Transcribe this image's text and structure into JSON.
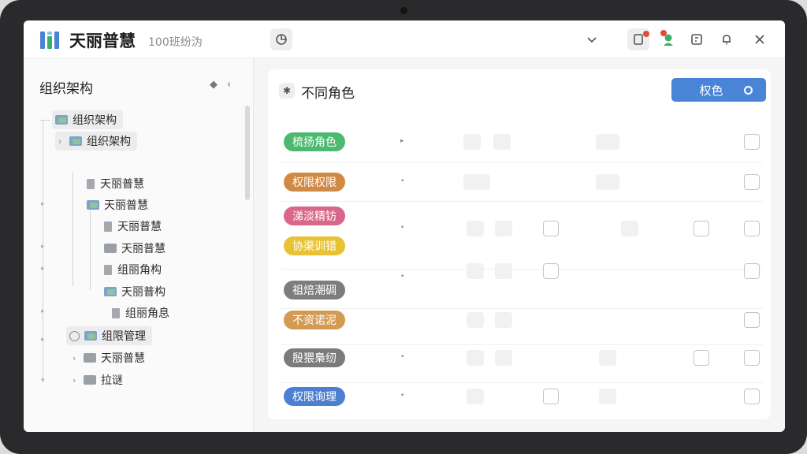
{
  "header": {
    "app_title": "天丽普慧",
    "app_subtitle": "100班纷沩",
    "icons": [
      "chart-icon",
      "chevron-down-icon",
      "tablet-icon",
      "user-icon",
      "grid-icon",
      "bell-icon",
      "close-icon"
    ],
    "accent": "#4a84d6"
  },
  "sidebar": {
    "title": "组织架构",
    "tree": [
      {
        "label": "组织架构"
      },
      {
        "label": "组织架构"
      },
      {
        "label": "天丽普慧"
      },
      {
        "label": "天丽普慧"
      },
      {
        "label": "天丽普慧"
      },
      {
        "label": "天丽普慧"
      },
      {
        "label": "组丽角构"
      },
      {
        "label": "天丽普构"
      },
      {
        "label": "组丽角息"
      },
      {
        "label": "组限管理"
      },
      {
        "label": "天丽普慧"
      },
      {
        "label": "拉谜"
      }
    ]
  },
  "main": {
    "title": "不同角色",
    "primary_button": "权色",
    "roles": [
      {
        "label": "梳扬角色",
        "color": "#4cb870"
      },
      {
        "label": "权限权限",
        "color": "#d08a45"
      },
      {
        "label": "涕淡精钫",
        "color": "#d9678b"
      },
      {
        "label": "协渠训错",
        "color": "#e9c234"
      },
      {
        "label": "祖焙潮碉",
        "color": "#7d7d80"
      },
      {
        "label": "不资诺泥",
        "color": "#d39a52"
      },
      {
        "label": "殷猥梟纫",
        "color": "#7b7b7e"
      },
      {
        "label": "权限询理",
        "color": "#4c7fcf"
      }
    ]
  }
}
